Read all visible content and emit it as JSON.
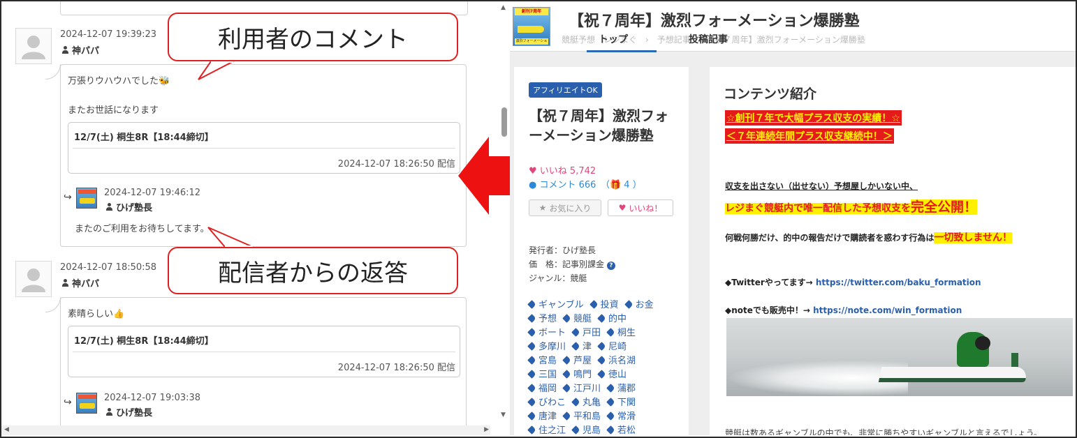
{
  "left_pane": {
    "comments": [
      {
        "date": "2024-12-07 19:39:23",
        "user": "神パパ",
        "lines": [
          "万張りウハウハでした🐝",
          "またお世話になります"
        ],
        "issue": {
          "title": "12/7(土) 桐生8R【18:44締切】",
          "date": "2024-12-07 18:26:50 配信"
        },
        "reply": {
          "date": "2024-12-07 19:46:12",
          "user": "ひげ塾長",
          "text": "またのご利用をお待ちしてます。"
        }
      },
      {
        "date": "2024-12-07 18:50:58",
        "user": "神パパ",
        "lines": [
          "素晴らしい👍"
        ],
        "issue": {
          "title": "12/7(土) 桐生8R【18:44締切】",
          "date": "2024-12-07 18:26:50 配信"
        },
        "reply": {
          "date": "2024-12-07 19:03:38",
          "user": "ひげ塾長",
          "text": ""
        }
      }
    ],
    "callouts": {
      "user_comment": "利用者のコメント",
      "author_reply": "配信者からの返答"
    }
  },
  "right_pane": {
    "header": {
      "site_title": "【祝７周年】激烈フォーメーション爆勝塾",
      "breadcrumb": "競艇予想　レジまぐ　›　予想記事　›　【祝７周年】激烈フォーメーション爆勝塾",
      "nav": [
        "トップ",
        "投稿記事"
      ],
      "logo_top": "創刊7周年",
      "logo_bottom": "激烈フォーメーション爆勝塾"
    },
    "sidebar": {
      "badge": "アフィリエイトOK",
      "title": "【祝７周年】激烈フォーメーション爆勝塾",
      "likes": "いいね 5,742",
      "comments": "コメント 666",
      "gifts": "4",
      "fav_button": "お気に入り",
      "like_button": "いいね！",
      "publisher": "発行者：ひげ塾長",
      "price": "価　格：記事別課金",
      "genre": "ジャンル：競艇",
      "tags": [
        "ギャンブル",
        "投資",
        "お金",
        "予想",
        "競艇",
        "的中",
        "ボート",
        "戸田",
        "桐生",
        "多摩川",
        "津",
        "尼崎",
        "宮島",
        "芦屋",
        "浜名湖",
        "三国",
        "鳴門",
        "徳山",
        "福岡",
        "江戸川",
        "蒲郡",
        "びわこ",
        "丸亀",
        "下関",
        "唐津",
        "平和島",
        "常滑",
        "住之江",
        "児島",
        "若松"
      ]
    },
    "main": {
      "section_title": "コンテンツ紹介",
      "highlight1": "☆創刊７年で大幅プラス収支の実績！☆",
      "highlight2": "＜７年連続年間プラス収支継続中！＞",
      "line1": "収支を出さない（出せない）予想屋しかいない中、",
      "line2a": "レジまぐ競艇内で唯一配信した予想収支を",
      "line2b": "完全公開！",
      "line3a": "何戦何勝だけ、的中の報告だけで購読者を惑わす行為は",
      "line3b": "一切致しません！",
      "twitter_label": "◆Twitterやってます→ ",
      "twitter_url": "https://twitter.com/baku_formation",
      "note_label": "◆noteでも販売中！→ ",
      "note_url": "https://note.com/win_formation",
      "tail": "競艇は数あるギャンブルの中でも、非常に勝ちやすいギャンブルと言えるでしょう。"
    }
  }
}
